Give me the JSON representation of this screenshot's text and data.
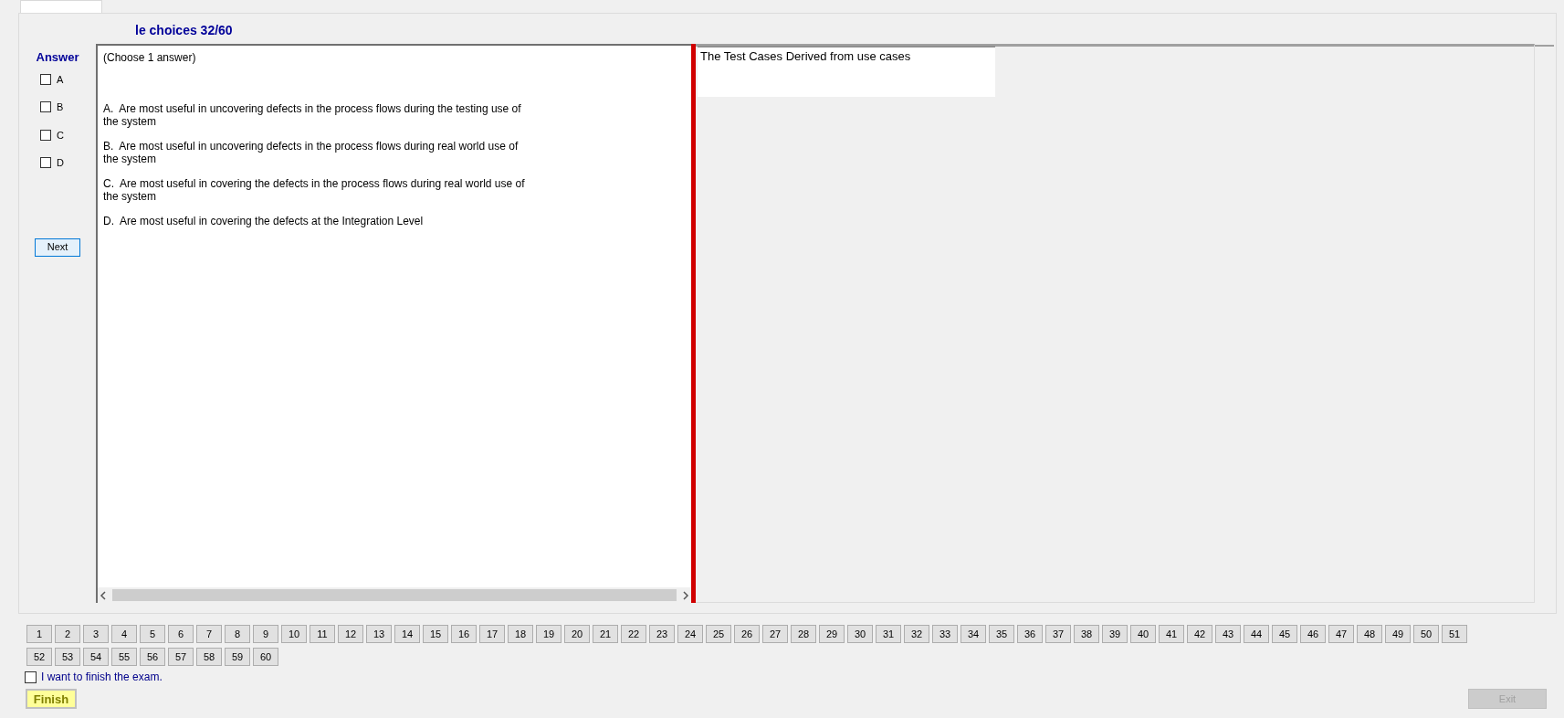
{
  "title": "le choices 32/60",
  "answer_panel": {
    "heading": "Answer",
    "options": [
      {
        "label": "A",
        "checked": false
      },
      {
        "label": "B",
        "checked": false
      },
      {
        "label": "C",
        "checked": false
      },
      {
        "label": "D",
        "checked": false
      }
    ],
    "next_button": "Next"
  },
  "question": {
    "instruction": "(Choose 1 answer)",
    "choices": [
      {
        "text": "A.  Are most useful in uncovering defects in the process flows during the testing use of the system"
      },
      {
        "text": "B.  Are most useful in uncovering defects in the process flows during real world use of the system"
      },
      {
        "text": "C.  Are most useful in covering the defects in the process flows during real world use of the system"
      },
      {
        "text": "D.  Are most useful in covering the defects at the Integration Level"
      }
    ]
  },
  "stem": "The Test Cases Derived from use cases",
  "question_numbers": [
    "1",
    "2",
    "3",
    "4",
    "5",
    "6",
    "7",
    "8",
    "9",
    "10",
    "11",
    "12",
    "13",
    "14",
    "15",
    "16",
    "17",
    "18",
    "19",
    "20",
    "21",
    "22",
    "23",
    "24",
    "25",
    "26",
    "27",
    "28",
    "29",
    "30",
    "31",
    "32",
    "33",
    "34",
    "35",
    "36",
    "37",
    "38",
    "39",
    "40",
    "41",
    "42",
    "43",
    "44",
    "45",
    "46",
    "47",
    "48",
    "49",
    "50",
    "51",
    "52",
    "53",
    "54",
    "55",
    "56",
    "57",
    "58",
    "59",
    "60"
  ],
  "finish_confirm": {
    "label": "I want to finish the exam.",
    "checked": false
  },
  "finish_button": "Finish",
  "exit_button": {
    "label": "Exit",
    "disabled": true
  }
}
